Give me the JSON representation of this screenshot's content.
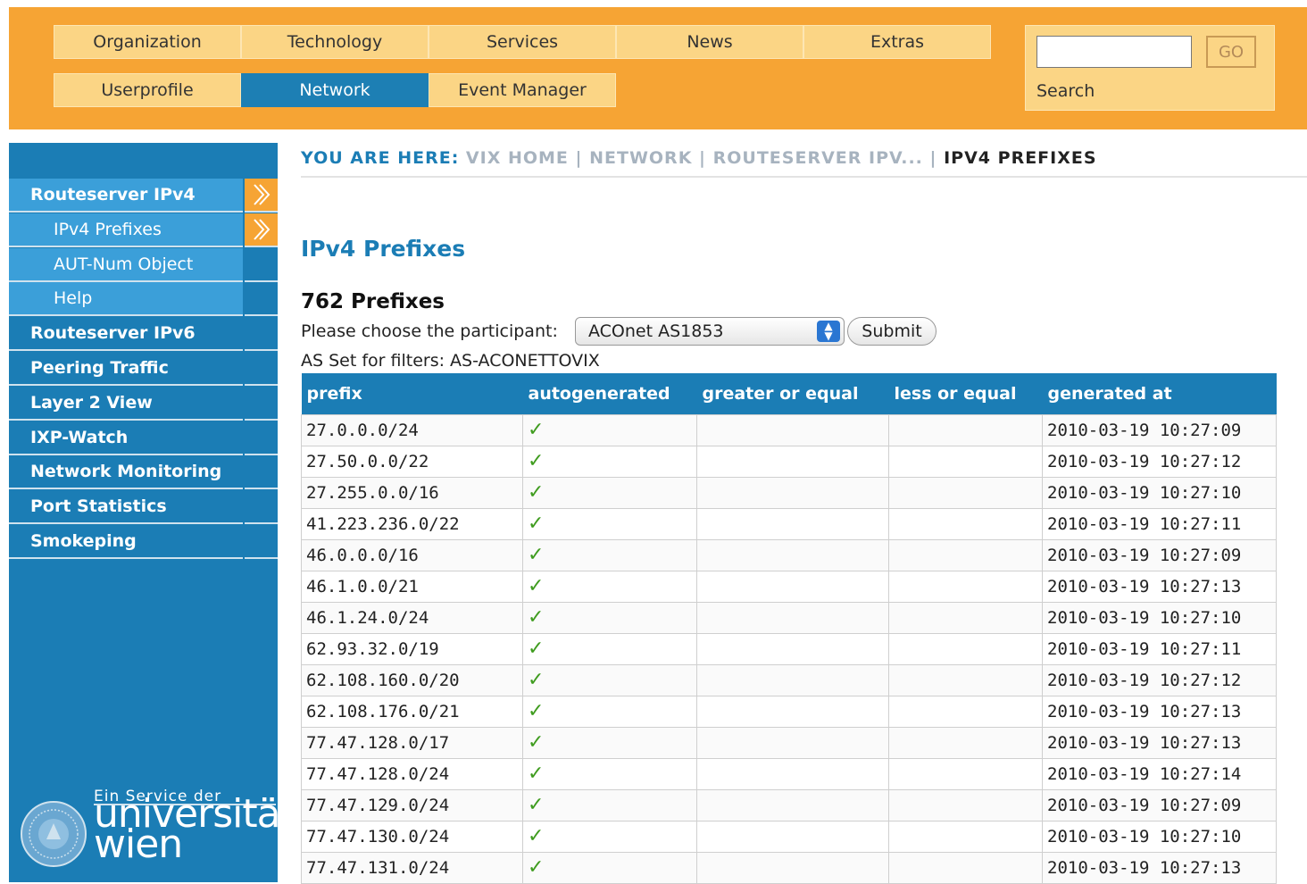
{
  "nav": {
    "row1": [
      "Organization",
      "Technology",
      "Services",
      "News",
      "Extras"
    ],
    "row2": [
      "Userprofile",
      "Network",
      "Event Manager"
    ],
    "active": "Network"
  },
  "search": {
    "value": "",
    "placeholder": "",
    "button_label": "GO",
    "label": "Search"
  },
  "sidebar": {
    "items": [
      {
        "label": "Routeserver IPv4",
        "level": 0,
        "highlight": true
      },
      {
        "label": "IPv4 Prefixes",
        "level": 1,
        "highlight": true
      },
      {
        "label": "AUT-Num Object",
        "level": 1,
        "highlight": true
      },
      {
        "label": "Help",
        "level": 1,
        "highlight": true
      },
      {
        "label": "Routeserver IPv6",
        "level": 0
      },
      {
        "label": "Peering Traffic",
        "level": 0
      },
      {
        "label": "Layer 2 View",
        "level": 0
      },
      {
        "label": "IXP-Watch",
        "level": 0
      },
      {
        "label": "Network Monitoring",
        "level": 0
      },
      {
        "label": "Port Statistics",
        "level": 0
      },
      {
        "label": "Smokeping",
        "level": 0
      }
    ],
    "service_line": "Ein Service der",
    "logo_text_1": "universität",
    "logo_text_2": "wien"
  },
  "breadcrumb": {
    "prefix": "YOU ARE HERE:",
    "crumbs": [
      "VIX HOME",
      "NETWORK",
      "ROUTESERVER IPV..."
    ],
    "current": "IPV4 PREFIXES",
    "separator": "|"
  },
  "main": {
    "title": "IPv4 Prefixes",
    "count": "762 Prefixes",
    "choose_label": "Please choose the participant:",
    "participant_selected": "ACOnet AS1853",
    "submit_label": "Submit",
    "as_set_label": "AS Set for filters: AS-ACONETTOVIX"
  },
  "table": {
    "columns": [
      "prefix",
      "autogenerated",
      "greater or equal",
      "less or equal",
      "generated at"
    ],
    "check_glyph": "✓",
    "rows": [
      [
        "27.0.0.0/24",
        true,
        "",
        "",
        "2010-03-19 10:27:09"
      ],
      [
        "27.50.0.0/22",
        true,
        "",
        "",
        "2010-03-19 10:27:12"
      ],
      [
        "27.255.0.0/16",
        true,
        "",
        "",
        "2010-03-19 10:27:10"
      ],
      [
        "41.223.236.0/22",
        true,
        "",
        "",
        "2010-03-19 10:27:11"
      ],
      [
        "46.0.0.0/16",
        true,
        "",
        "",
        "2010-03-19 10:27:09"
      ],
      [
        "46.1.0.0/21",
        true,
        "",
        "",
        "2010-03-19 10:27:13"
      ],
      [
        "46.1.24.0/24",
        true,
        "",
        "",
        "2010-03-19 10:27:10"
      ],
      [
        "62.93.32.0/19",
        true,
        "",
        "",
        "2010-03-19 10:27:11"
      ],
      [
        "62.108.160.0/20",
        true,
        "",
        "",
        "2010-03-19 10:27:12"
      ],
      [
        "62.108.176.0/21",
        true,
        "",
        "",
        "2010-03-19 10:27:13"
      ],
      [
        "77.47.128.0/17",
        true,
        "",
        "",
        "2010-03-19 10:27:13"
      ],
      [
        "77.47.128.0/24",
        true,
        "",
        "",
        "2010-03-19 10:27:14"
      ],
      [
        "77.47.129.0/24",
        true,
        "",
        "",
        "2010-03-19 10:27:09"
      ],
      [
        "77.47.130.0/24",
        true,
        "",
        "",
        "2010-03-19 10:27:10"
      ],
      [
        "77.47.131.0/24",
        true,
        "",
        "",
        "2010-03-19 10:27:13"
      ]
    ]
  },
  "colors": {
    "header_orange": "#f6a434",
    "nav_button": "#fbd585",
    "brand_blue": "#1b7db5",
    "sidebar_highlight": "#3b9fd9",
    "check_green": "#3f9c1f"
  }
}
